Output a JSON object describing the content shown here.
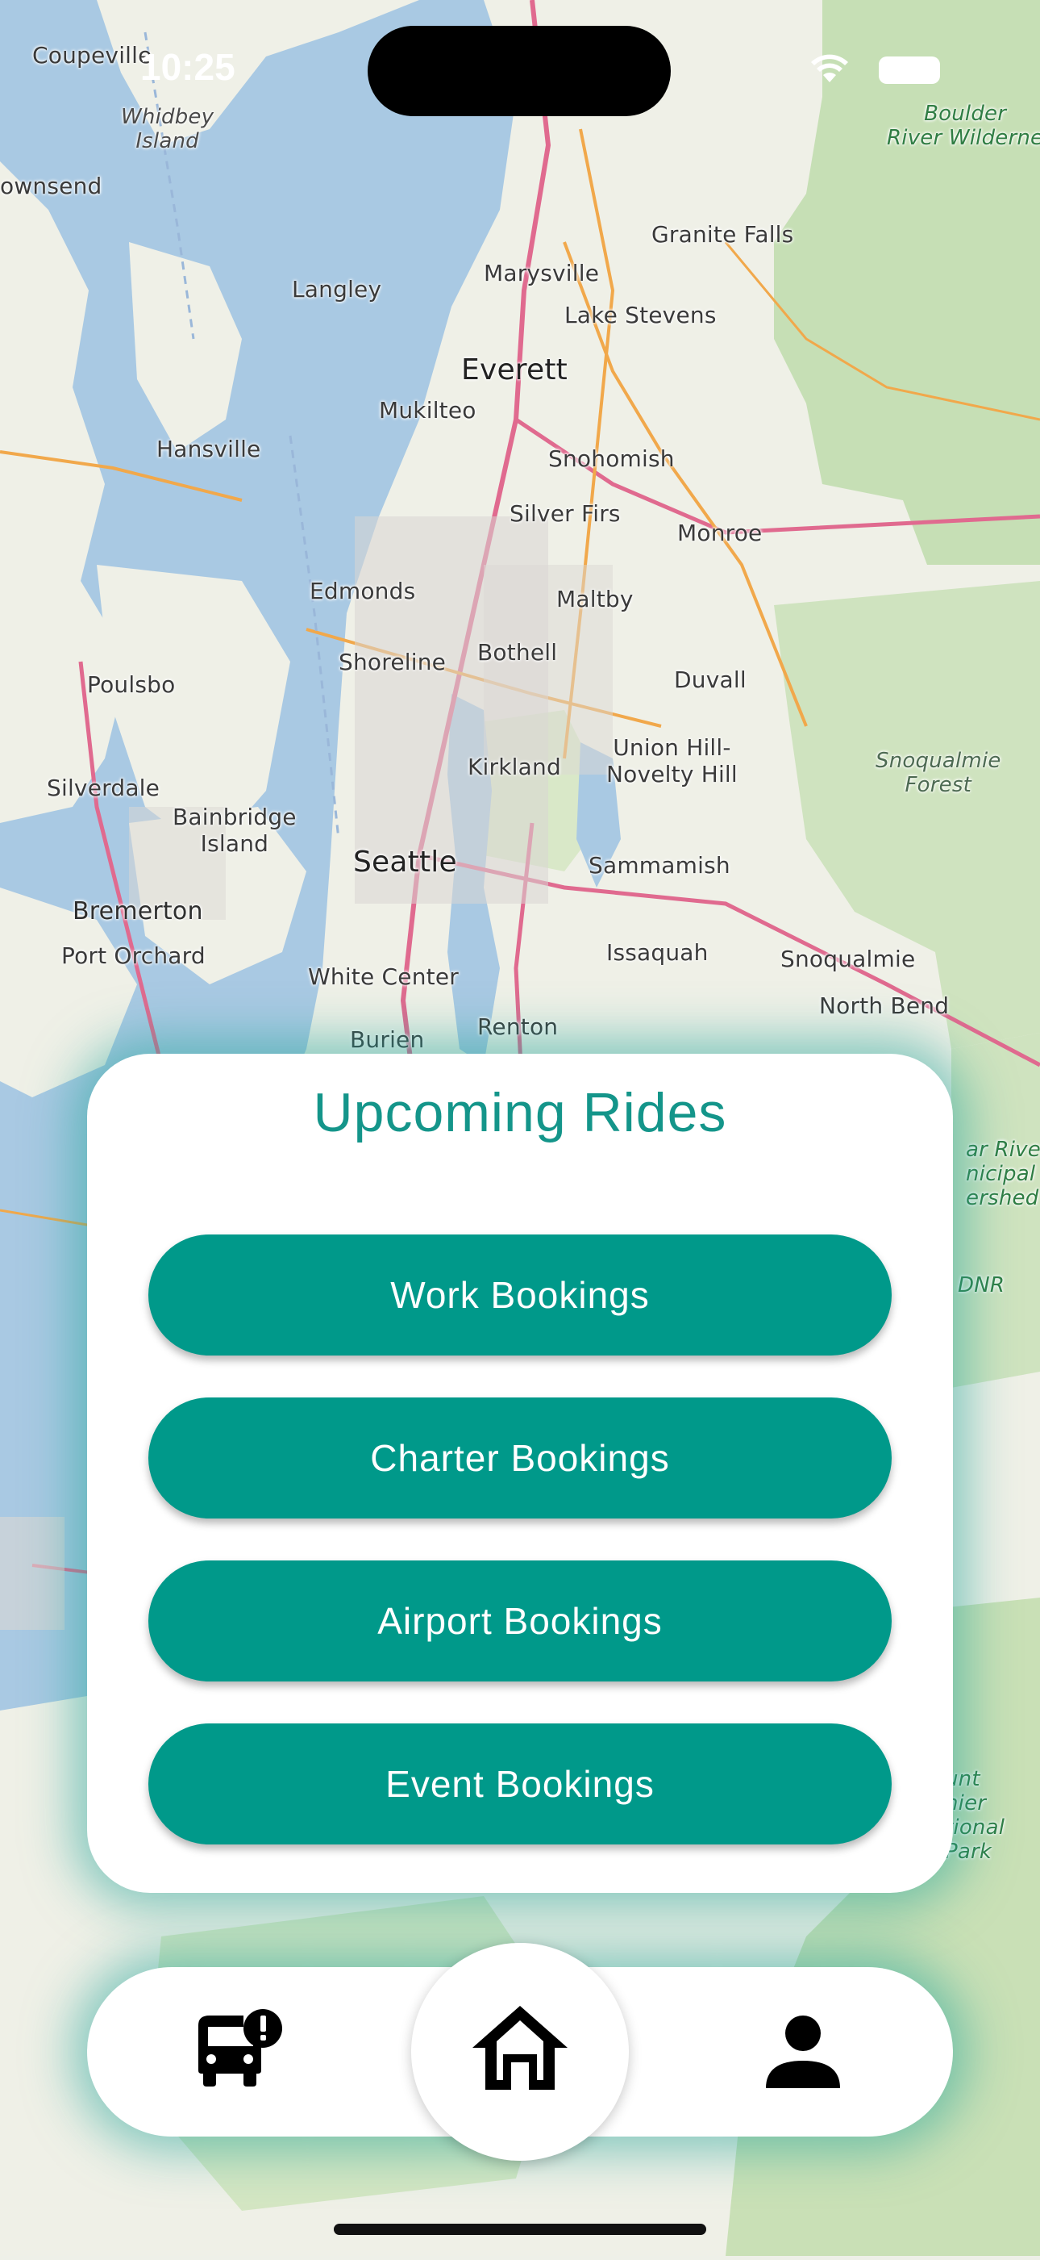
{
  "status_bar": {
    "time": "10:25"
  },
  "map": {
    "labels": {
      "coupeville": "Coupeville",
      "whidbey": "Whidbey\nIsland",
      "townsend": "ownsend",
      "langley": "Langley",
      "marysville": "Marysville",
      "granite_falls": "Granite Falls",
      "lake_stevens": "Lake Stevens",
      "everett": "Everett",
      "mukilteo": "Mukilteo",
      "hansville": "Hansville",
      "snohomish": "Snohomish",
      "silver_firs": "Silver Firs",
      "monroe": "Monroe",
      "edmonds": "Edmonds",
      "maltby": "Maltby",
      "poulsbo": "Poulsbo",
      "shoreline": "Shoreline",
      "bothell": "Bothell",
      "duvall": "Duvall",
      "kirkland": "Kirkland",
      "union_hill": "Union Hill-\nNovelty Hill",
      "silverdale": "Silverdale",
      "bainbridge": "Bainbridge\nIsland",
      "seattle": "Seattle",
      "sammamish": "Sammamish",
      "bremerton": "Bremerton",
      "port_orchard": "Port Orchard",
      "issaquah": "Issaquah",
      "snoqualmie": "Snoqualmie",
      "north_bend": "North Bend",
      "white_center": "White Center",
      "burien": "Burien",
      "renton": "Renton",
      "boulder_river": "Boulder\nRiver Wilderne",
      "snoqualmie_forest": "Snoqualmie\nForest",
      "cedar_river": "ar River\nnicipal\nershed",
      "dnr": "DNR",
      "mount_rainier": "unt\nnier\ntional\nPark"
    }
  },
  "card": {
    "title": "Upcoming Rides",
    "buttons": [
      "Work Bookings",
      "Charter Bookings",
      "Airport Bookings",
      "Event Bookings"
    ]
  },
  "nav": {
    "items": [
      {
        "icon": "bus-alert-icon"
      },
      {
        "icon": "home-icon"
      },
      {
        "icon": "person-icon"
      }
    ]
  },
  "colors": {
    "accent": "#00998a",
    "title": "#14958a"
  }
}
